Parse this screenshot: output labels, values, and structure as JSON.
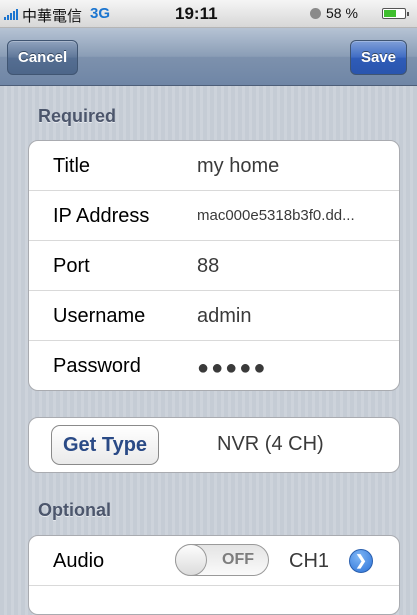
{
  "status_bar": {
    "carrier": "中華電信",
    "network": "3G",
    "time": "19:11",
    "battery": "58 %",
    "battery_level": 0.58
  },
  "nav": {
    "cancel_label": "Cancel",
    "save_label": "Save"
  },
  "required": {
    "header": "Required",
    "rows": [
      {
        "label": "Title",
        "value": "my home"
      },
      {
        "label": "IP Address",
        "value": "mac000e5318b3f0.dd..."
      },
      {
        "label": "Port",
        "value": "88"
      },
      {
        "label": "Username",
        "value": "admin"
      },
      {
        "label": "Password",
        "value": "●●●●●"
      }
    ]
  },
  "device_type": {
    "button_label": "Get Type",
    "value": "NVR (4 CH)"
  },
  "optional": {
    "header": "Optional",
    "audio": {
      "label": "Audio",
      "toggle": "OFF",
      "channel": "CH1"
    }
  }
}
